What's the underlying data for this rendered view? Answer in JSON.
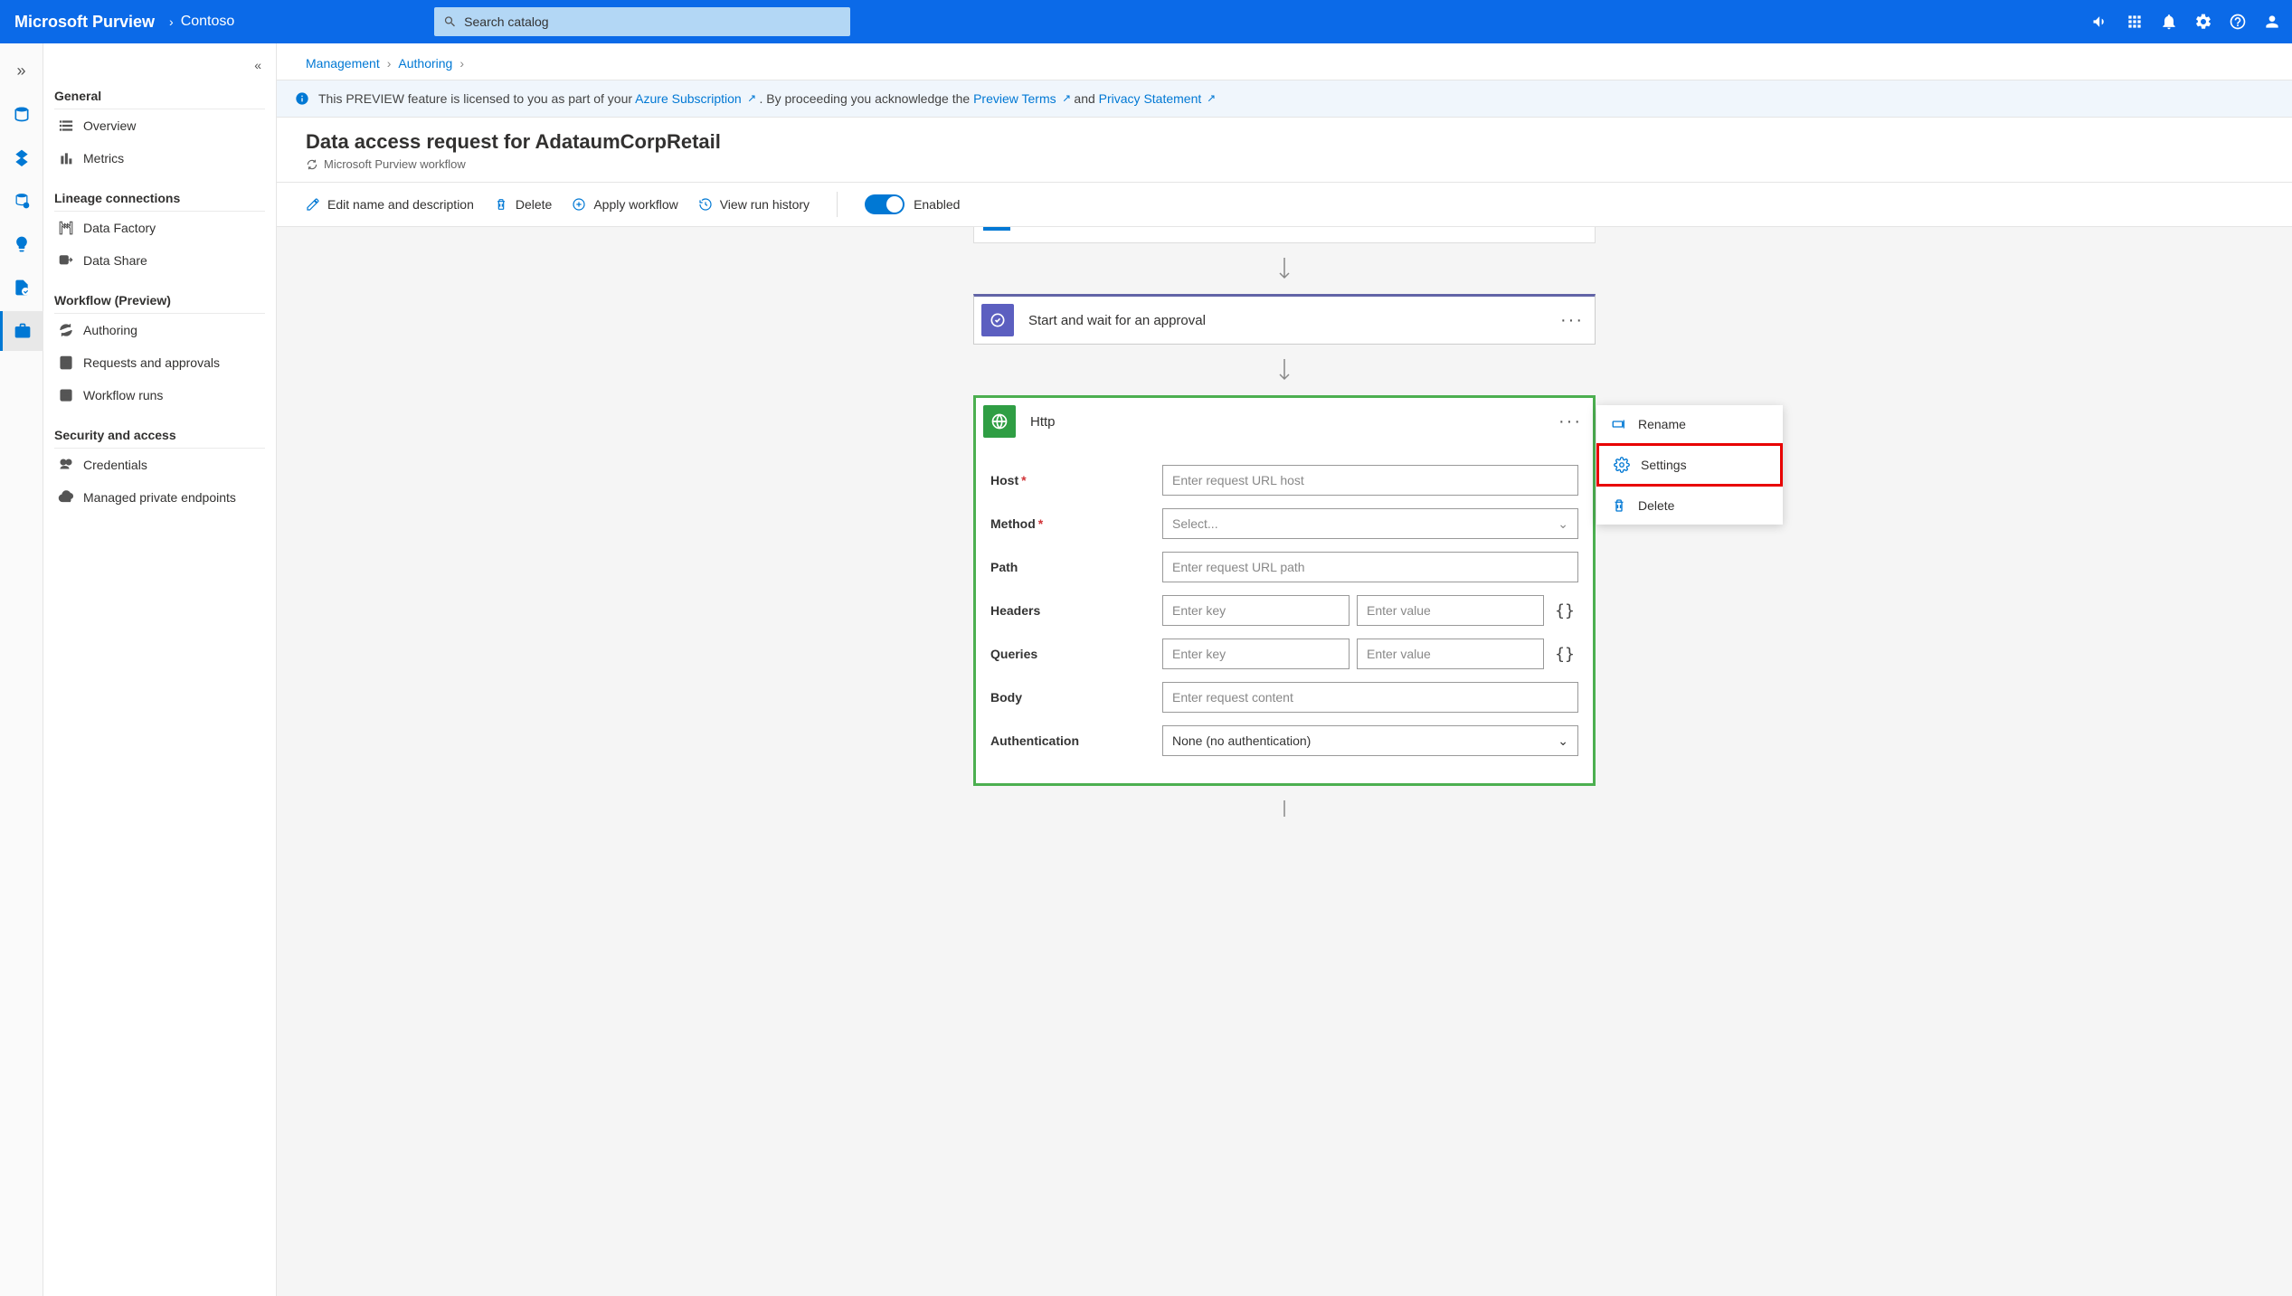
{
  "header": {
    "app_title": "Microsoft Purview",
    "org_name": "Contoso",
    "search_placeholder": "Search catalog"
  },
  "sidebar": {
    "collapse_icon": "«",
    "sections": [
      {
        "title": "General",
        "items": [
          {
            "label": "Overview",
            "icon": "list"
          },
          {
            "label": "Metrics",
            "icon": "chart"
          }
        ]
      },
      {
        "title": "Lineage connections",
        "items": [
          {
            "label": "Data Factory",
            "icon": "factory"
          },
          {
            "label": "Data Share",
            "icon": "share"
          }
        ]
      },
      {
        "title": "Workflow (Preview)",
        "items": [
          {
            "label": "Authoring",
            "icon": "cycle"
          },
          {
            "label": "Requests and approvals",
            "icon": "checklist"
          },
          {
            "label": "Workflow runs",
            "icon": "runs"
          }
        ]
      },
      {
        "title": "Security and access",
        "items": [
          {
            "label": "Credentials",
            "icon": "key"
          },
          {
            "label": "Managed private endpoints",
            "icon": "cloud"
          }
        ]
      }
    ]
  },
  "breadcrumb": {
    "items": [
      "Management",
      "Authoring"
    ]
  },
  "preview_bar": {
    "prefix": "This PREVIEW feature is licensed to you as part of your ",
    "link1": "Azure Subscription",
    "middle1": ". By proceeding you acknowledge the ",
    "link2": "Preview Terms",
    "middle2": " and ",
    "link3": "Privacy Statement"
  },
  "page": {
    "title": "Data access request for AdataumCorpRetail",
    "subtitle": "Microsoft Purview workflow"
  },
  "toolbar": {
    "edit": "Edit name and description",
    "delete": "Delete",
    "apply": "Apply workflow",
    "history": "View run history",
    "enabled": "Enabled"
  },
  "flow": {
    "approval_title": "Start and wait for an approval",
    "http_title": "Http",
    "fields": {
      "host": {
        "label": "Host",
        "placeholder": "Enter request URL host"
      },
      "method": {
        "label": "Method",
        "placeholder": "Select..."
      },
      "path": {
        "label": "Path",
        "placeholder": "Enter request URL path"
      },
      "headers": {
        "label": "Headers",
        "key_placeholder": "Enter key",
        "value_placeholder": "Enter value"
      },
      "queries": {
        "label": "Queries",
        "key_placeholder": "Enter key",
        "value_placeholder": "Enter value"
      },
      "body": {
        "label": "Body",
        "placeholder": "Enter request content"
      },
      "auth": {
        "label": "Authentication",
        "value": "None (no authentication)"
      }
    }
  },
  "context_menu": {
    "rename": "Rename",
    "settings": "Settings",
    "delete": "Delete"
  }
}
